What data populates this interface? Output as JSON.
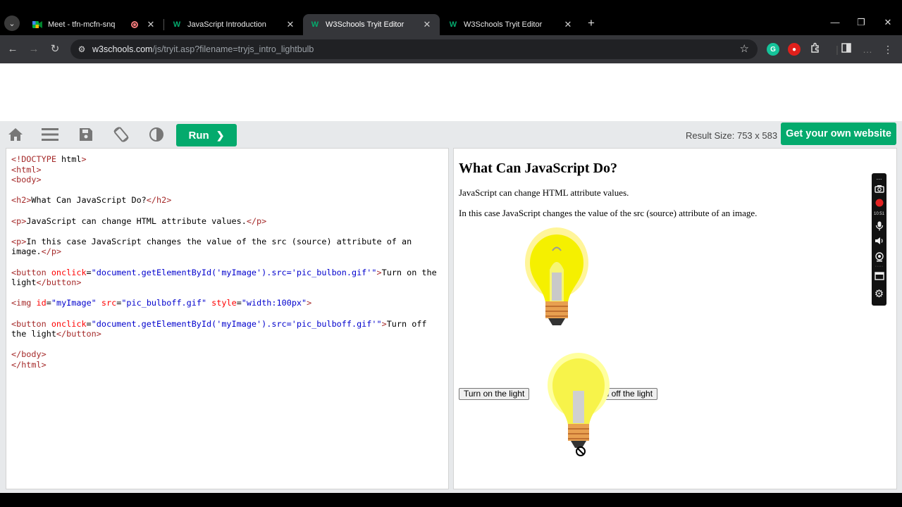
{
  "browser": {
    "tabs": [
      {
        "title": "Meet - tfn-mcfn-snq",
        "active": false
      },
      {
        "title": "JavaScript Introduction",
        "active": false
      },
      {
        "title": "W3Schools Tryit Editor",
        "active": true
      },
      {
        "title": "W3Schools Tryit Editor",
        "active": false
      }
    ],
    "url_host": "w3schools.com",
    "url_path": "/js/tryit.asp?filename=tryjs_intro_lightbulb",
    "extension_grammarly": "G"
  },
  "w3": {
    "run_label": "Run",
    "result_size": "Result Size: 753 x 583",
    "get_website_label": "Get your own website"
  },
  "code_lines": [
    "<!DOCTYPE html>",
    "<html>",
    "<body>",
    "",
    "<h2>What Can JavaScript Do?</h2>",
    "",
    "<p>JavaScript can change HTML attribute values.</p>",
    "",
    "<p>In this case JavaScript changes the value of the src (source) attribute of an image.</p>",
    "",
    "<button onclick=\"document.getElementById('myImage').src='pic_bulbon.gif'\">Turn on the light</button>",
    "",
    "<img id=\"myImage\" src=\"pic_bulboff.gif\" style=\"width:100px\">",
    "",
    "<button onclick=\"document.getElementById('myImage').src='pic_bulboff.gif'\">Turn off the light</button>",
    "",
    "</body>",
    "</html>"
  ],
  "result": {
    "heading": "What Can JavaScript Do?",
    "para1": "JavaScript can change HTML attribute values.",
    "para2": "In this case JavaScript changes the value of the src (source) attribute of an image.",
    "btn_on": "Turn on the light",
    "btn_off": "Turn off the light"
  },
  "recorder": {
    "time": "10:51"
  }
}
